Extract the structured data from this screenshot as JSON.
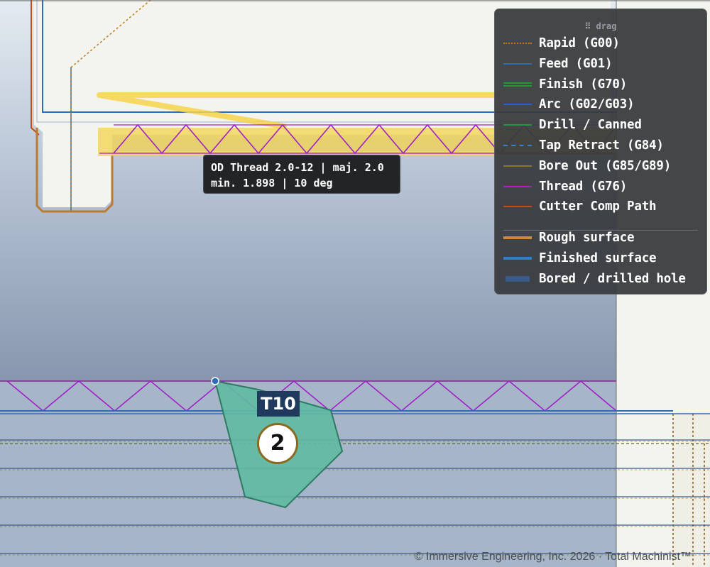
{
  "tooltip": {
    "line1": "OD Thread 2.0-12 | maj. 2.0",
    "line2": "min. 1.898 | 10 deg"
  },
  "legend": {
    "drag_label": "⠿ drag",
    "items": [
      {
        "label": "Rapid (G00)",
        "color": "#c07a1a",
        "style": "dotted"
      },
      {
        "label": "Feed (G01)",
        "color": "#2d6db8",
        "style": "solid"
      },
      {
        "label": "Finish (G70)",
        "color": "#1e9a3c",
        "style": "double"
      },
      {
        "label": "Arc (G02/G03)",
        "color": "#2b5fd0",
        "style": "solid"
      },
      {
        "label": "Drill / Canned",
        "color": "#1e9a3c",
        "style": "solid"
      },
      {
        "label": "Tap Retract (G84)",
        "color": "#3a7fd0",
        "style": "dashed"
      },
      {
        "label": "Bore Out (G85/G89)",
        "color": "#8a7a22",
        "style": "solid"
      },
      {
        "label": "Thread (G76)",
        "color": "#b01ec8",
        "style": "solid"
      },
      {
        "label": "Cutter Comp Path",
        "color": "#c44d14",
        "style": "solid"
      },
      {
        "label": "Rough surface",
        "color": "#c98a3a",
        "style": "thick"
      },
      {
        "label": "Finished surface",
        "color": "#2e7fc8",
        "style": "thick"
      },
      {
        "label": "Bored / drilled hole",
        "color": "#3a5a8a",
        "style": "block"
      }
    ]
  },
  "tool": {
    "name": "T10",
    "number": "2",
    "insert_color": "#5fbaa2"
  },
  "colors": {
    "thread": "#a020c8",
    "rapid": "#c07a1a",
    "feed": "#2d6db8",
    "rough": "#b97b34",
    "cutter_comp": "#c44d14",
    "highlight": "#f4d34a",
    "stock_top": "#dfe6ee",
    "stock_bottom": "#8a99b0"
  },
  "footer": "© Immersive Engineering, Inc. 2026 · Total Machinist™"
}
